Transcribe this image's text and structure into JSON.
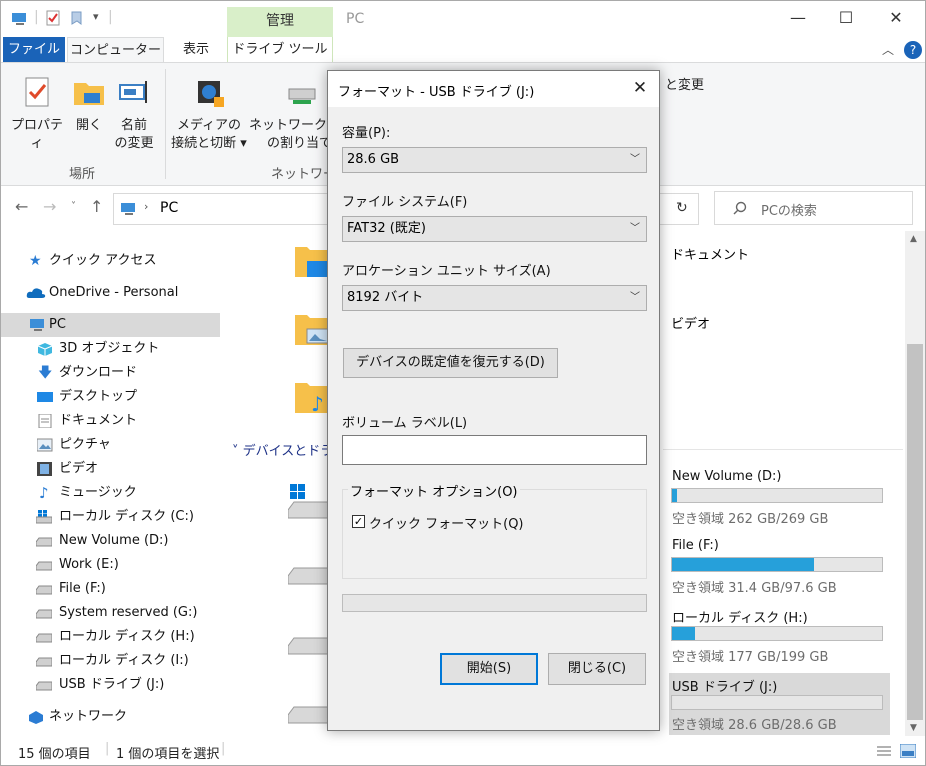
{
  "window": {
    "title": "PC",
    "context_tab": "管理",
    "controls": {
      "minimize": "—",
      "maximize": "☐",
      "close": "✕"
    }
  },
  "ribbon": {
    "tabs": [
      {
        "label": "ファイル"
      },
      {
        "label": "コンピューター"
      },
      {
        "label": "表示"
      },
      {
        "label": "ドライブ ツール"
      }
    ],
    "buttons": {
      "properties": "プロパティ",
      "open": "開く",
      "rename_l1": "名前",
      "rename_l2": "の変更",
      "media_l1": "メディアの",
      "media_l2": "接続と切断 ▾",
      "network_l1": "ネットワーク ド",
      "network_l2": "の割り当て",
      "change": "と変更"
    },
    "groups": {
      "location": "場所",
      "network": "ネットワーク"
    }
  },
  "address": {
    "path": "PC",
    "search_placeholder": "PCの検索"
  },
  "nav": {
    "items": [
      {
        "label": "クイック アクセス"
      },
      {
        "label": "OneDrive - Personal"
      },
      {
        "label": "PC"
      },
      {
        "label": "3D オブジェクト"
      },
      {
        "label": "ダウンロード"
      },
      {
        "label": "デスクトップ"
      },
      {
        "label": "ドキュメント"
      },
      {
        "label": "ピクチャ"
      },
      {
        "label": "ビデオ"
      },
      {
        "label": "ミュージック"
      },
      {
        "label": "ローカル ディスク (C:)"
      },
      {
        "label": "New Volume (D:)"
      },
      {
        "label": "Work (E:)"
      },
      {
        "label": "File (F:)"
      },
      {
        "label": "System reserved (G:)"
      },
      {
        "label": "ローカル ディスク (H:)"
      },
      {
        "label": "ローカル ディスク (I:)"
      },
      {
        "label": "USB ドライブ (J:)"
      },
      {
        "label": "ネットワーク"
      }
    ]
  },
  "content": {
    "folders": [
      {
        "label": "ドキュメント"
      },
      {
        "label": "ビデオ"
      }
    ],
    "section_devices": "デバイスとドライ",
    "drives": [
      {
        "name": "New Volume (D:)",
        "space": "空き領域 262 GB/269 GB",
        "used_fraction": 0.026
      },
      {
        "name": "File (F:)",
        "space": "空き領域 31.4 GB/97.6 GB",
        "used_fraction": 0.678
      },
      {
        "name": "ローカル ディスク (H:)",
        "space": "空き領域 177 GB/199 GB",
        "used_fraction": 0.111
      },
      {
        "name": "USB ドライブ (J:)",
        "space": "空き領域 28.6 GB/28.6 GB",
        "used_fraction": 0.0
      }
    ]
  },
  "status": {
    "count": "15 個の項目",
    "selected": "1 個の項目を選択"
  },
  "dialog": {
    "title": "フォーマット - USB ドライブ (J:)",
    "capacity_label": "容量(P):",
    "capacity_value": "28.6 GB",
    "fs_label": "ファイル システム(F)",
    "fs_value": "FAT32 (既定)",
    "alloc_label": "アロケーション ユニット サイズ(A)",
    "alloc_value": "8192 バイト",
    "restore_button": "デバイスの既定値を復元する(D)",
    "volume_label": "ボリューム ラベル(L)",
    "volume_value": "",
    "options_title": "フォーマット オプション(O)",
    "quick_format": "クイック フォーマット(Q)",
    "quick_format_checked": true,
    "progress": 0,
    "start_button": "開始(S)",
    "close_button": "閉じる(C)"
  }
}
